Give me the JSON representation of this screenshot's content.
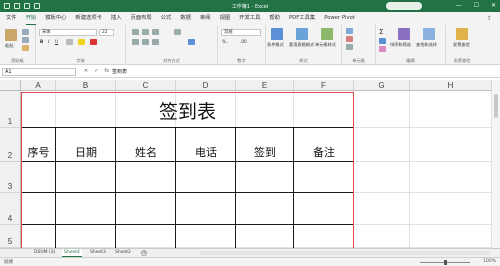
{
  "titlebar": {
    "doc_title": "工作簿1 - Excel",
    "minimize": "—",
    "maximize": "☐",
    "close": "✕"
  },
  "menu": {
    "tabs": [
      "文件",
      "开始",
      "模板中心",
      "新建选项卡",
      "插入",
      "页面布局",
      "公式",
      "数据",
      "审阅",
      "视图",
      "开发工具",
      "帮助",
      "PDF工具集",
      "Power Pivot"
    ],
    "active_index": 1,
    "share_icon": "share-icon"
  },
  "ribbon": {
    "paste": "粘贴",
    "clipboard": "剪贴板",
    "font_name": "宋体",
    "font_size": "22",
    "font_group": "字体",
    "align_group": "对齐方式",
    "number_format": "常规",
    "number_group": "数字",
    "cond_format": "条件格式",
    "table_format": "套用表格格式",
    "cell_style": "单元格样式",
    "style_group": "样式",
    "cells_label": "单元格",
    "sort_filter": "排序和筛选",
    "find_select": "查找和选择",
    "edit_group": "编辑",
    "invoice": "发票查验",
    "invoice_group": "发票查验"
  },
  "formula": {
    "name_box": "A1",
    "cancel": "✕",
    "enter": "✓",
    "fx": "fx",
    "content": "签到表"
  },
  "grid": {
    "columns": [
      "A",
      "B",
      "C",
      "D",
      "E",
      "F",
      "G",
      "H"
    ],
    "rows": [
      "1",
      "2",
      "3",
      "4",
      "5"
    ],
    "title": "签到表",
    "headers": [
      "序号",
      "日期",
      "姓名",
      "电话",
      "签到",
      "备注"
    ]
  },
  "sheets": {
    "tabs": [
      "DSUM (3)",
      "Sheet4",
      "Sheet3",
      "Sheet2"
    ],
    "active_index": 1,
    "add": "+"
  },
  "status": {
    "ready": "就绪",
    "zoom": "100%"
  },
  "colors": {
    "accent": "#217346",
    "outline": "#e04a4a"
  }
}
